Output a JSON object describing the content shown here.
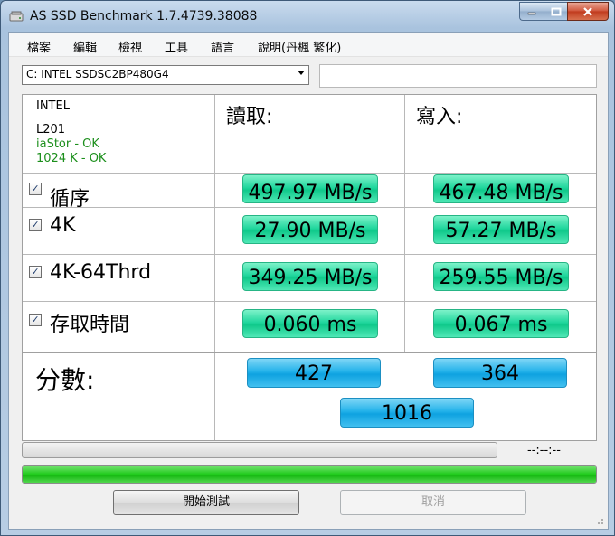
{
  "window": {
    "title": "AS SSD Benchmark 1.7.4739.38088"
  },
  "menu": [
    "檔案",
    "編輯",
    "檢視",
    "工具",
    "語言",
    "說明(丹楓 繁化)"
  ],
  "drive": {
    "selected": "C: INTEL SSDSC2BP480G4"
  },
  "info": {
    "lines": [
      "INTEL",
      "L201",
      "iaStor - OK",
      "1024 K - OK"
    ]
  },
  "columns": {
    "read": "讀取:",
    "write": "寫入:"
  },
  "rows": [
    {
      "label": "循序",
      "checked": true,
      "read": "497.97 MB/s",
      "write": "467.48 MB/s"
    },
    {
      "label": "4K",
      "checked": true,
      "read": "27.90 MB/s",
      "write": "57.27 MB/s"
    },
    {
      "label": "4K-64Thrd",
      "checked": true,
      "read": "349.25 MB/s",
      "write": "259.55 MB/s"
    },
    {
      "label": "存取時間",
      "checked": true,
      "read": "0.060 ms",
      "write": "0.067 ms"
    }
  ],
  "score": {
    "label": "分數:",
    "read": "427",
    "write": "364",
    "total": "1016"
  },
  "progress": {
    "time": "--:--:--",
    "main_fraction": 1.0
  },
  "buttons": {
    "start": "開始測試",
    "cancel": "取消"
  }
}
